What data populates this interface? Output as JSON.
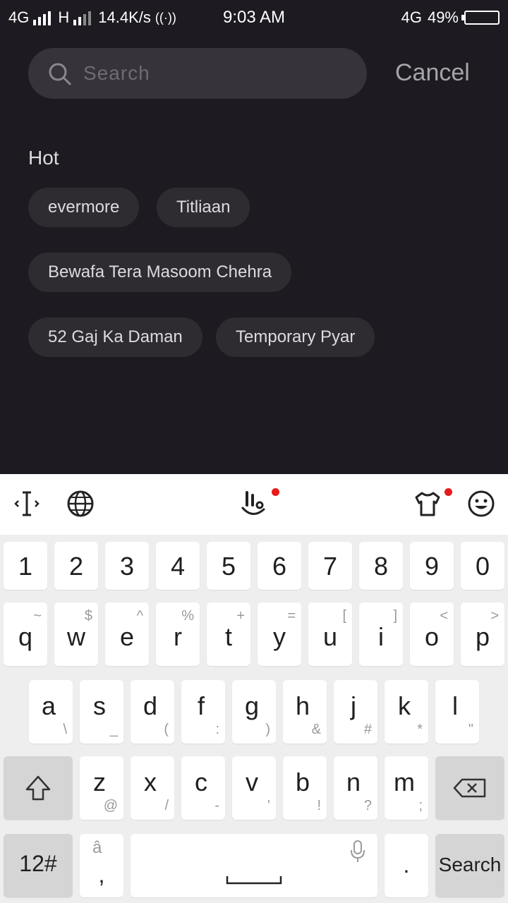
{
  "status_bar": {
    "network1": "4G",
    "network2": "H",
    "speed": "14.4K/s",
    "time": "9:03 AM",
    "network3": "4G",
    "battery": "49%",
    "battery_level": 0.49
  },
  "search": {
    "placeholder": "Search",
    "value": "",
    "cancel_label": "Cancel"
  },
  "hot": {
    "title": "Hot",
    "chips": [
      "evermore",
      "Titliaan",
      "Bewafa Tera Masoom Chehra",
      "52 Gaj Ka Daman",
      "Temporary Pyar"
    ]
  },
  "keyboard": {
    "number_row": [
      "1",
      "2",
      "3",
      "4",
      "5",
      "6",
      "7",
      "8",
      "9",
      "0"
    ],
    "row_qwerty": [
      {
        "main": "q",
        "sec": "~"
      },
      {
        "main": "w",
        "sec": "$"
      },
      {
        "main": "e",
        "sec": "^"
      },
      {
        "main": "r",
        "sec": "%"
      },
      {
        "main": "t",
        "sec": "+"
      },
      {
        "main": "y",
        "sec": "="
      },
      {
        "main": "u",
        "sec": "["
      },
      {
        "main": "i",
        "sec": "]"
      },
      {
        "main": "o",
        "sec": "<"
      },
      {
        "main": "p",
        "sec": ">"
      }
    ],
    "row_asdf": [
      {
        "main": "a",
        "sec": "\\"
      },
      {
        "main": "s",
        "sec": "_"
      },
      {
        "main": "d",
        "sec": "("
      },
      {
        "main": "f",
        "sec": ":"
      },
      {
        "main": "g",
        "sec": ")"
      },
      {
        "main": "h",
        "sec": "&"
      },
      {
        "main": "j",
        "sec": "#"
      },
      {
        "main": "k",
        "sec": "*"
      },
      {
        "main": "l",
        "sec": "\""
      }
    ],
    "row_zxcv": [
      {
        "main": "z",
        "sec": "@"
      },
      {
        "main": "x",
        "sec": "/"
      },
      {
        "main": "c",
        "sec": "-"
      },
      {
        "main": "v",
        "sec": "'"
      },
      {
        "main": "b",
        "sec": "!"
      },
      {
        "main": "n",
        "sec": "?"
      },
      {
        "main": "m",
        "sec": ";"
      }
    ],
    "symbols_label": "12#",
    "comma_label": ",",
    "period_label": ".",
    "search_label": "Search",
    "toolbar_icons": [
      "cursor-icon",
      "globe-icon",
      "gesture-icon",
      "theme-shirt-icon",
      "emoji-icon"
    ],
    "accent_dot_color": "#e81a1a"
  }
}
